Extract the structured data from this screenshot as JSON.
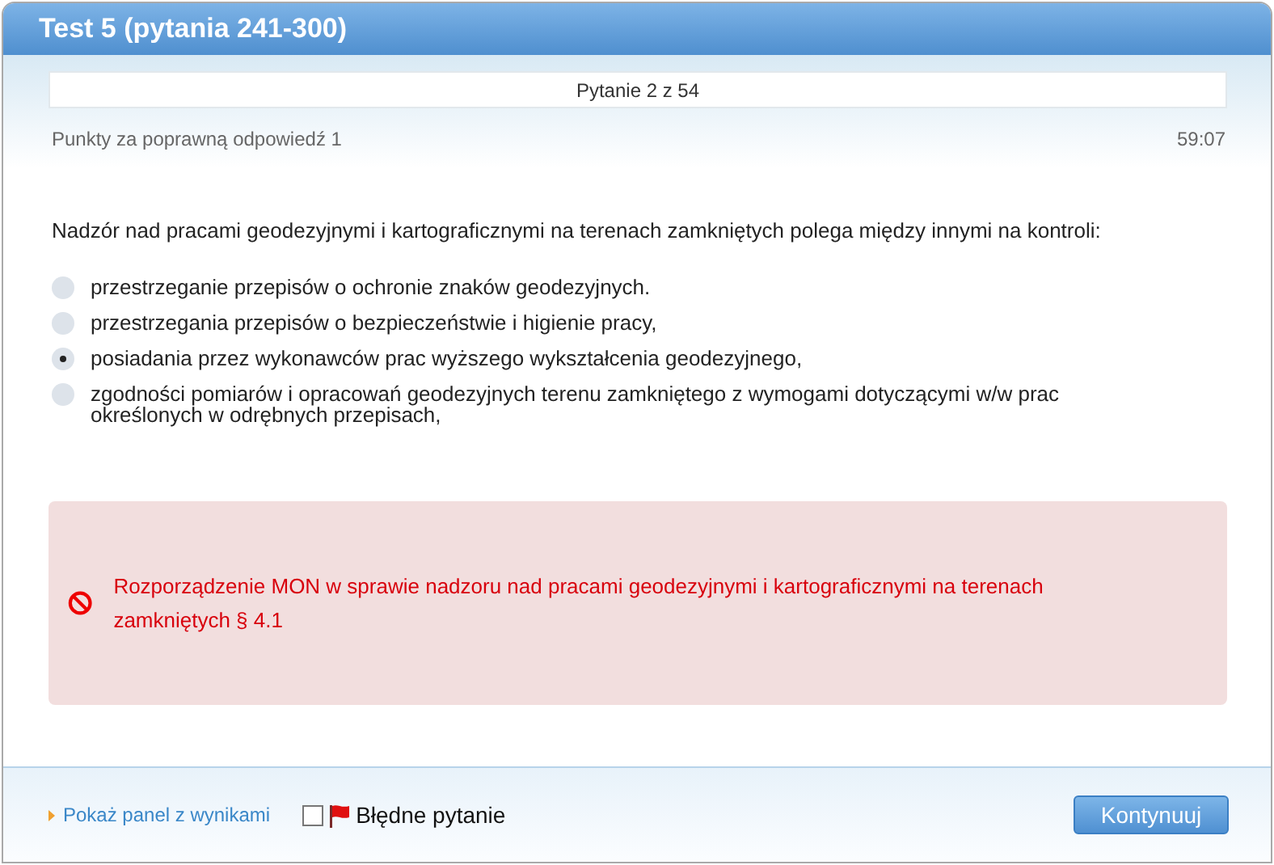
{
  "window": {
    "title": "Test 5 (pytania 241-300)"
  },
  "progress": "Pytanie 2 z 54",
  "points": "Punkty za poprawną odpowiedź 1",
  "timer": "59:07",
  "question": "Nadzór nad pracami geodezyjnymi i kartograficznymi na terenach zamkniętych polega między innymi na kontroli:",
  "answers": [
    {
      "text": "przestrzeganie przepisów o ochronie znaków geodezyjnych.",
      "selected": false
    },
    {
      "text": "przestrzegania przepisów o bezpieczeństwie i higienie pracy,",
      "selected": false
    },
    {
      "text": "posiadania przez wykonawców prac wyższego wykształcenia geodezyjnego,",
      "selected": true
    },
    {
      "text": "zgodności pomiarów i opracowań geodezyjnych terenu zamkniętego z wymogami dotyczącymi w/w prac określonych w odrębnych przepisach,",
      "selected": false
    }
  ],
  "feedback": {
    "text": "Rozporządzenie MON w sprawie nadzoru nad pracami geodezyjnymi i kartograficznymi na terenach zamkniętych § 4.1"
  },
  "footer": {
    "results_link": "Pokaż panel z wynikami",
    "flag": {
      "label": "Błędne pytanie",
      "checked": false
    },
    "button": "Kontynuuj"
  }
}
